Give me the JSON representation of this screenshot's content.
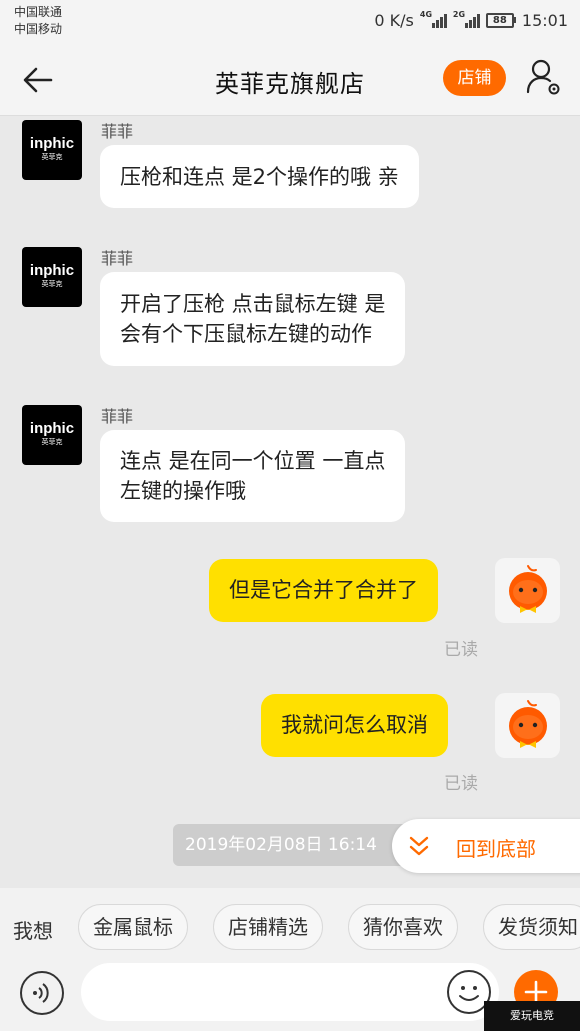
{
  "status_bar": {
    "carrier1": "中国联通",
    "carrier2": "中国移动",
    "net_speed": "0 K/s",
    "signal1_tag": "4G",
    "signal2_tag": "2G",
    "battery": "88",
    "time": "15:01"
  },
  "header": {
    "title": "英菲克旗舰店",
    "store_button": "店铺"
  },
  "messages": [
    {
      "direction": "in",
      "sender": "菲菲",
      "avatar_brand": "inphic",
      "avatar_sub": "英菲克",
      "lines": [
        "压枪和连点 是2个操作的哦 亲"
      ]
    },
    {
      "direction": "in",
      "sender": "菲菲",
      "avatar_brand": "inphic",
      "avatar_sub": "英菲克",
      "lines": [
        "开启了压枪  点击鼠标左键  是",
        "会有个下压鼠标左键的动作"
      ]
    },
    {
      "direction": "in",
      "sender": "菲菲",
      "avatar_brand": "inphic",
      "avatar_sub": "英菲克",
      "lines": [
        "连点 是在同一个位置 一直点",
        "左键的操作哦"
      ]
    },
    {
      "direction": "out",
      "text": "但是它合并了合并了",
      "status": "已读"
    },
    {
      "direction": "out",
      "text": "我就问怎么取消",
      "status": "已读"
    }
  ],
  "timestamp": "2019年02月08日 16:14",
  "back_to_bottom": "回到底部",
  "quick_reply": {
    "label": "我想",
    "chips": [
      "金属鼠标",
      "店铺精选",
      "猜你喜欢",
      "发货须知"
    ]
  },
  "input": {
    "placeholder": ""
  },
  "watermark": "爱玩电竞",
  "colors": {
    "accent": "#ff6a00",
    "outgoing_bubble": "#ffe000",
    "background": "#e9e9e9"
  }
}
